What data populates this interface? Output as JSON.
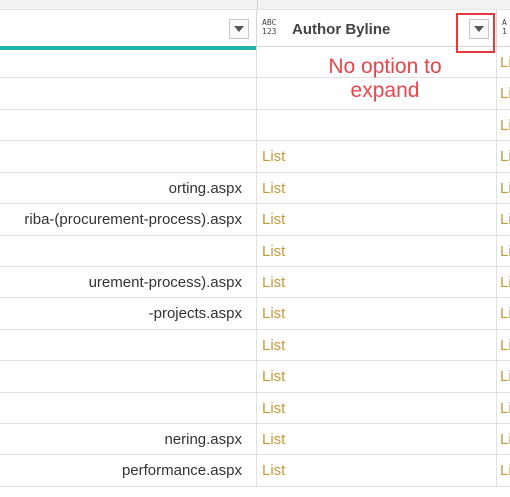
{
  "columns": {
    "col2": {
      "type_icon_top": "ABC",
      "type_icon_bottom": "123",
      "title": "Author Byline"
    },
    "col3": {
      "type_icon_top": "A",
      "type_icon_bottom": "1"
    }
  },
  "annotation": {
    "line1": "No option to",
    "line2": "expand"
  },
  "rows": [
    {
      "c1": "",
      "c2": "",
      "c3": "Li"
    },
    {
      "c1": "",
      "c2": "",
      "c3": "Li"
    },
    {
      "c1": "",
      "c2": "",
      "c3": "Li"
    },
    {
      "c1": "",
      "c2": "List",
      "c3": "Li"
    },
    {
      "c1": "orting.aspx",
      "c2": "List",
      "c3": "Li"
    },
    {
      "c1": "riba-(procurement-process).aspx",
      "c2": "List",
      "c3": "Li"
    },
    {
      "c1": "",
      "c2": "List",
      "c3": "Li"
    },
    {
      "c1": "urement-process).aspx",
      "c2": "List",
      "c3": "Li"
    },
    {
      "c1": "-projects.aspx",
      "c2": "List",
      "c3": "Li"
    },
    {
      "c1": "",
      "c2": "List",
      "c3": "Li"
    },
    {
      "c1": "",
      "c2": "List",
      "c3": "Li"
    },
    {
      "c1": "",
      "c2": "List",
      "c3": "Li"
    },
    {
      "c1": "nering.aspx",
      "c2": "List",
      "c3": "Li"
    },
    {
      "c1": "performance.aspx",
      "c2": "List",
      "c3": "Li"
    }
  ]
}
